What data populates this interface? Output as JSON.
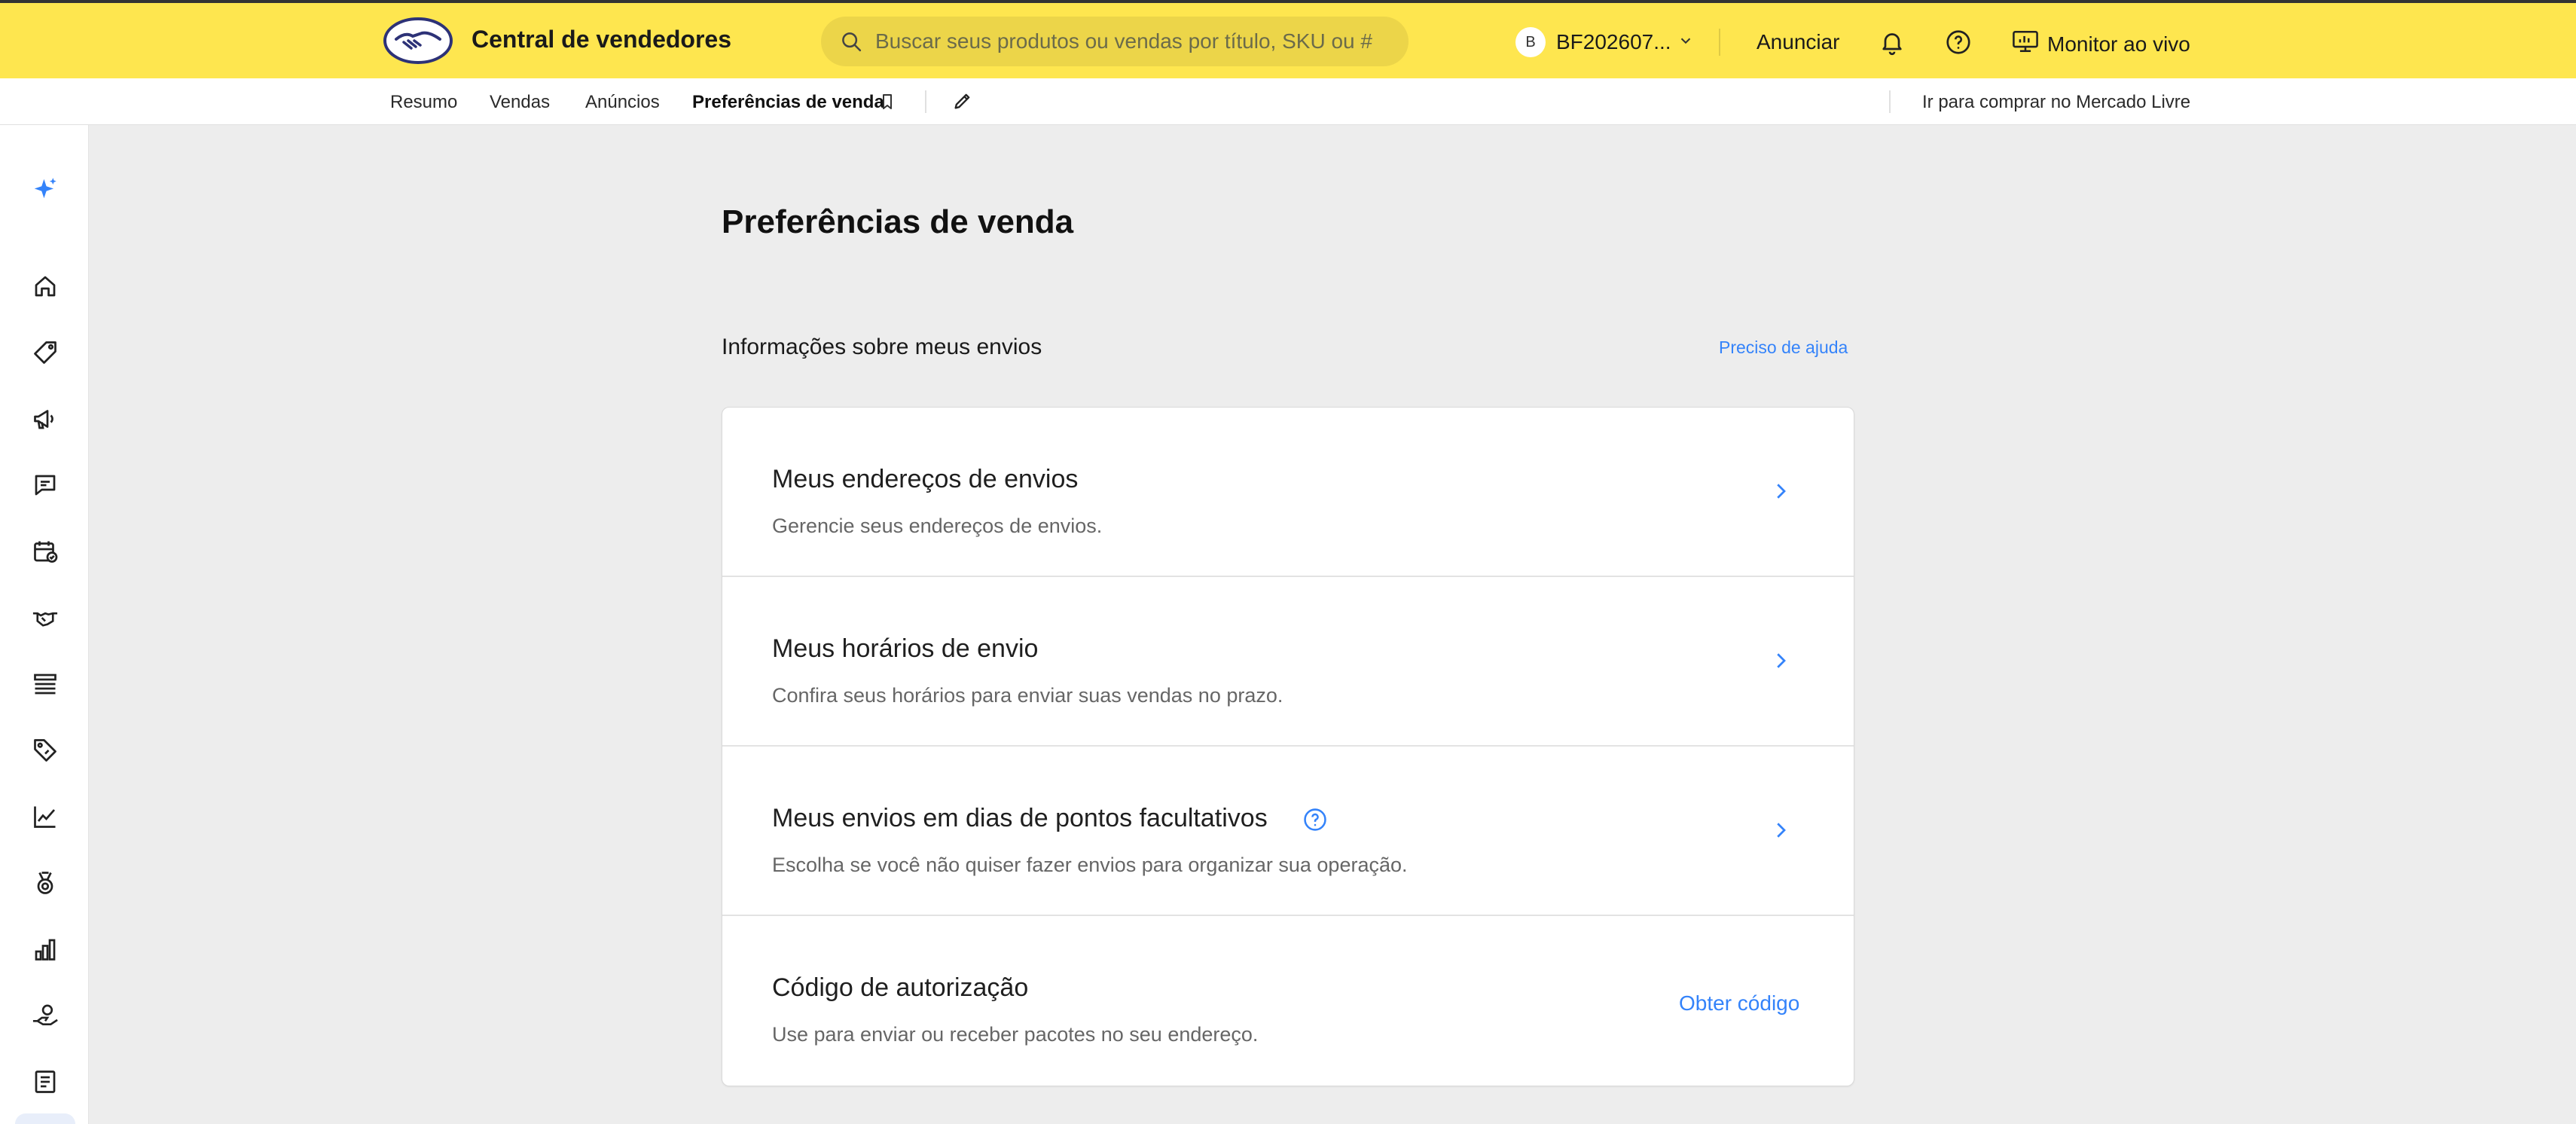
{
  "header": {
    "brand_name": "Central de vendedores",
    "search_placeholder": "Buscar seus produtos ou vendas por título, SKU ou #",
    "avatar_initial": "B",
    "account_id": "BF202607...",
    "anunciar_label": "Anunciar",
    "monitor_label": "Monitor ao vivo",
    "bg_color": "#fee64f"
  },
  "subnav": {
    "items": [
      {
        "label": "Resumo"
      },
      {
        "label": "Vendas"
      },
      {
        "label": "Anúncios"
      },
      {
        "label": "Preferências de venda",
        "active": true
      }
    ],
    "buy_link": "Ir para comprar no Mercado Livre"
  },
  "sidebar": {
    "icons": [
      "sparkle-icon",
      "home-icon",
      "tag-icon",
      "megaphone-icon",
      "chat-icon",
      "calendar-check-icon",
      "handshake-icon",
      "list-icon",
      "price-tag-icon",
      "line-chart-icon",
      "medal-icon",
      "bar-chart-icon",
      "hand-user-icon",
      "receipt-icon"
    ]
  },
  "main": {
    "page_title": "Preferências de venda",
    "section_title": "Informações sobre meus envios",
    "help_link": "Preciso de ajuda",
    "rows": [
      {
        "title": "Meus endereços de envios",
        "desc": "Gerencie seus endereços de envios."
      },
      {
        "title": "Meus horários de envio",
        "desc": "Confira seus horários para enviar suas vendas no prazo."
      },
      {
        "title": "Meus envios em dias de pontos facultativos",
        "desc": "Escolha se você não quiser fazer envios para organizar sua operação."
      },
      {
        "title": "Código de autorização",
        "desc": "Use para enviar ou receber pacotes no seu endereço.",
        "action": "Obter código"
      }
    ]
  },
  "colors": {
    "accent": "#3483fa",
    "page_bg": "#ededed"
  }
}
